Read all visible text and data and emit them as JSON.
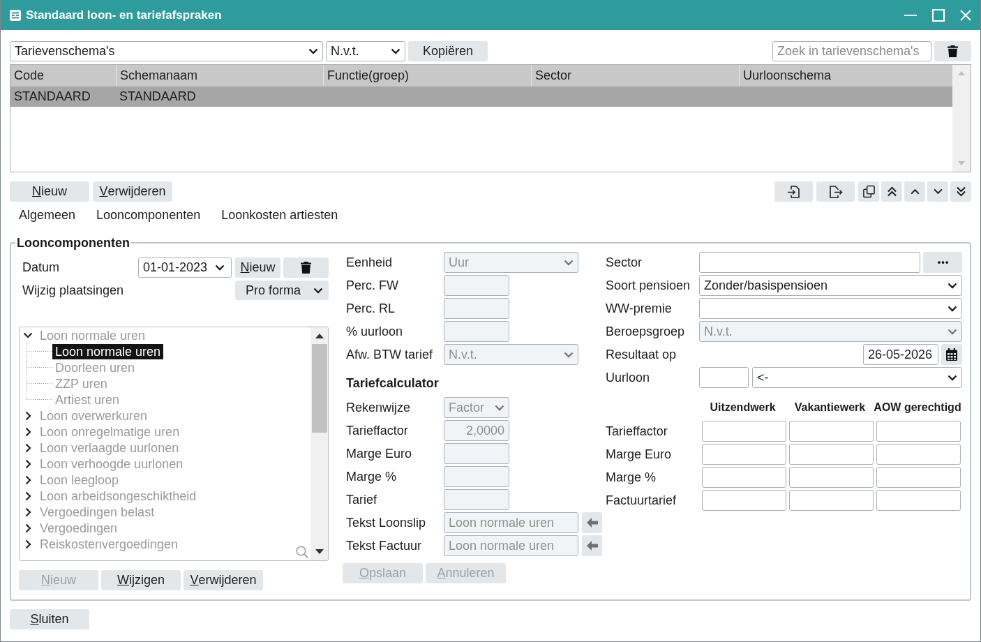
{
  "window": {
    "title": "Standaard loon- en tariefafspraken"
  },
  "toolbar": {
    "schema_select": {
      "value": "Tarievenschema's"
    },
    "filter_select": {
      "value": "N.v.t."
    },
    "copy_button": {
      "label": "Kopiëren"
    },
    "search": {
      "placeholder": "Zoek in tarievenschema's"
    }
  },
  "table": {
    "columns": [
      "Code",
      "Schemanaam",
      "Functie(groep)",
      "Sector",
      "Uurloonschema"
    ],
    "rows": [
      {
        "cells": [
          "STANDAARD",
          "STANDAARD"
        ],
        "selected": true
      }
    ]
  },
  "table_buttons": [
    {
      "label": "Nieuw",
      "mnemonic": true
    },
    {
      "label": "Verwijderen",
      "mnemonic": true
    }
  ],
  "tabs": [
    {
      "label": "Algemeen"
    },
    {
      "label": "Looncomponenten"
    },
    {
      "label": "Loonkosten artiesten"
    }
  ],
  "group": {
    "title": "Looncomponenten",
    "date": {
      "label": "Datum",
      "value": "01-01-2023"
    },
    "date_new_button": {
      "label": "Nieuw",
      "mnemonic": true
    },
    "mutations": {
      "label": "Wijzig plaatsingen",
      "value": "Pro forma"
    },
    "tree": [
      {
        "label": "Loon normale uren",
        "expanded": true,
        "selected": false,
        "disabled": true,
        "children": [
          {
            "label": "Loon normale uren",
            "selected": true,
            "disabled": false
          },
          {
            "label": "Doorleen uren",
            "selected": false,
            "disabled": true
          },
          {
            "label": "ZZP uren",
            "selected": false,
            "disabled": true
          },
          {
            "label": "Artiest uren",
            "selected": false,
            "disabled": true
          }
        ]
      },
      {
        "label": "Loon overwerkuren",
        "expanded": false,
        "selected": false,
        "disabled": true
      },
      {
        "label": "Loon onregelmatige uren",
        "expanded": false,
        "selected": false,
        "disabled": true
      },
      {
        "label": "Loon verlaagde uurlonen",
        "expanded": false,
        "selected": false,
        "disabled": true
      },
      {
        "label": "Loon verhoogde uurlonen",
        "expanded": false,
        "selected": false,
        "disabled": true
      },
      {
        "label": "Loon leegloop",
        "expanded": false,
        "selected": false,
        "disabled": true
      },
      {
        "label": "Loon arbeidsongeschiktheid",
        "expanded": false,
        "selected": false,
        "disabled": true
      },
      {
        "label": "Vergoedingen belast",
        "expanded": false,
        "selected": false,
        "disabled": true
      },
      {
        "label": "Vergoedingen",
        "expanded": false,
        "selected": false,
        "disabled": true
      },
      {
        "label": "Reiskostenvergoedingen",
        "expanded": false,
        "selected": false,
        "disabled": true
      }
    ],
    "tree_buttons": [
      {
        "label": "Nieuw",
        "mnemonic": true,
        "disabled": true
      },
      {
        "label": "Wijzigen",
        "mnemonic": true,
        "disabled": false
      },
      {
        "label": "Verwijderen",
        "mnemonic": true,
        "disabled": false
      }
    ],
    "details": [
      {
        "kind": "select",
        "label": "Eenheid",
        "value": "Uur",
        "disabled": true
      },
      {
        "kind": "input",
        "label": "Perc. FW",
        "disabled": true
      },
      {
        "kind": "input",
        "label": "Perc. RL",
        "disabled": true
      },
      {
        "kind": "input",
        "label": "% uurloon",
        "disabled": true
      },
      {
        "kind": "select",
        "label": "Afw. BTW tarief",
        "value": "N.v.t.",
        "disabled": true
      },
      {
        "kind": "heading",
        "label": "Tariefcalculator"
      },
      {
        "kind": "short_select",
        "label": "Rekenwijze",
        "value": "Factor",
        "disabled": true
      },
      {
        "kind": "input",
        "label": "Tarieffactor",
        "value": "2,0000",
        "disabled": true
      },
      {
        "kind": "input",
        "label": "Marge Euro",
        "disabled": true
      },
      {
        "kind": "input",
        "label": "Marge %",
        "disabled": true
      },
      {
        "kind": "input",
        "label": "Tarief",
        "disabled": true
      },
      {
        "kind": "copy_text",
        "label": "Tekst Loonslip",
        "value": "Loon normale uren",
        "disabled": true
      },
      {
        "kind": "copy_text",
        "label": "Tekst Factuur",
        "value": "Loon normale uren",
        "disabled": true
      }
    ],
    "detail_buttons": [
      {
        "label": "Opslaan",
        "mnemonic": true,
        "disabled": true
      },
      {
        "label": "Annuleren",
        "mnemonic": true,
        "disabled": true
      }
    ],
    "settings": [
      {
        "kind": "picker",
        "label": "Sector",
        "disabled": false
      },
      {
        "kind": "select",
        "label": "Soort pensioen",
        "value": "Zonder/basispensioen",
        "disabled": false
      },
      {
        "kind": "select",
        "label": "WW-premie",
        "disabled": false
      },
      {
        "kind": "select",
        "label": "Beroepsgroep",
        "value": "N.v.t.",
        "disabled": true
      },
      {
        "kind": "date",
        "label": "Resultaat op",
        "value": "26-05-2026",
        "disabled": false
      },
      {
        "kind": "amount",
        "label": "Uurloon",
        "value": "<-",
        "disabled": false
      }
    ],
    "rates": {
      "columns": [
        "Uitzendwerk",
        "Vakantiewerk",
        "AOW gerechtigd"
      ],
      "rows": [
        {
          "label": "Tarieffactor"
        },
        {
          "label": "Marge Euro"
        },
        {
          "label": "Marge %"
        },
        {
          "label": "Factuurtarief"
        }
      ]
    }
  },
  "close_button": {
    "label": "Sluiten",
    "mnemonic": true
  }
}
